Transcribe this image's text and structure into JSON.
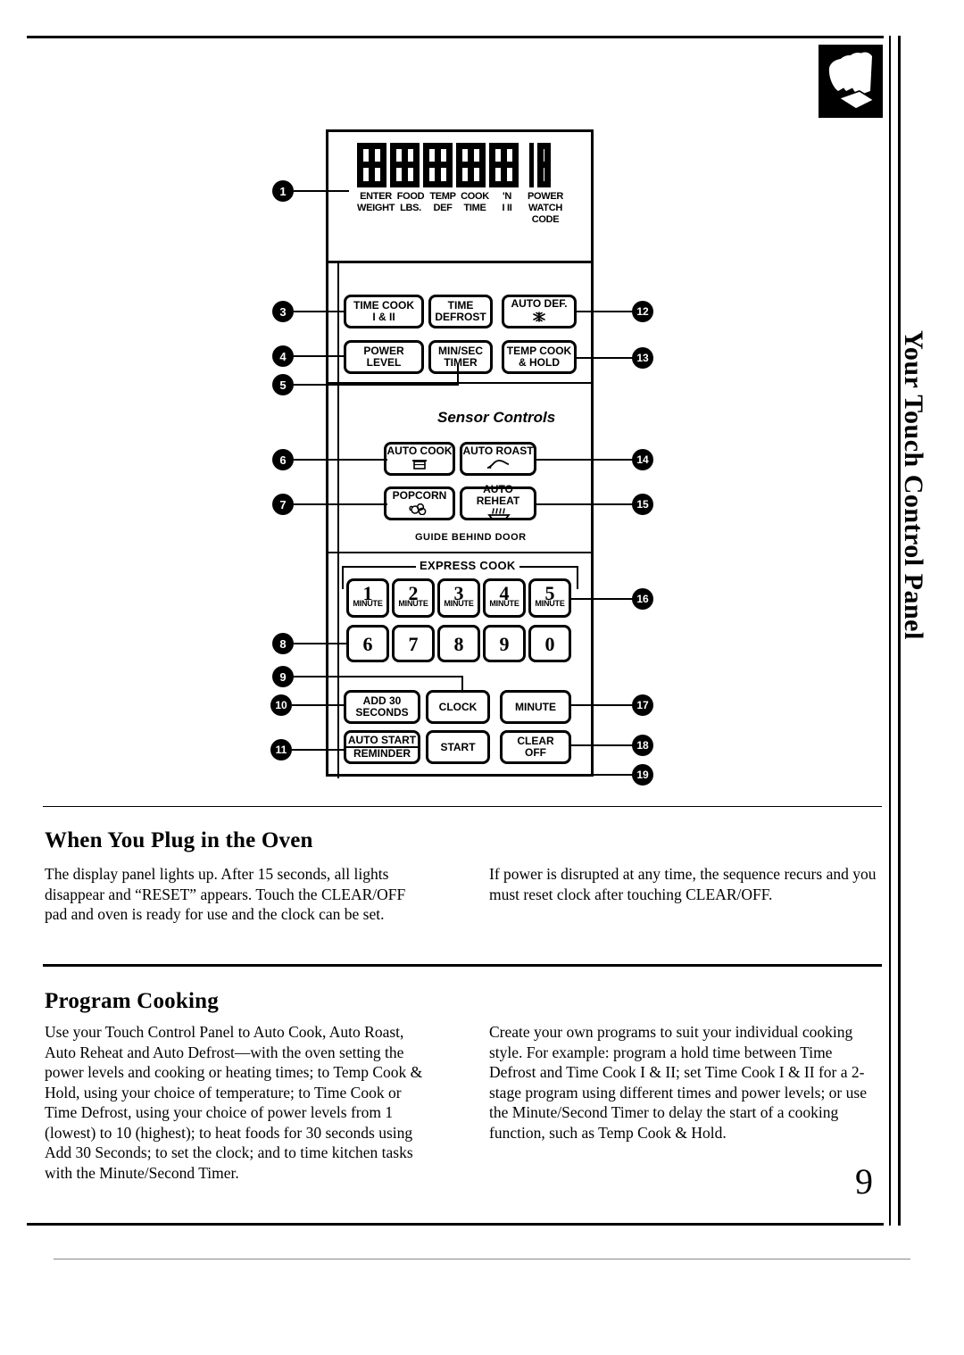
{
  "page": {
    "number": "9",
    "side_tab": "Your Touch Control Panel"
  },
  "icons": {
    "hand_press": "hand-pressing-icon"
  },
  "control_panel": {
    "display": {
      "readout": "88888 18",
      "labels": [
        {
          "top": "ENTER",
          "bottom": "WEIGHT"
        },
        {
          "top": "FOOD",
          "bottom": "LBS."
        },
        {
          "top": "TEMP",
          "bottom": "DEF"
        },
        {
          "top": "COOK",
          "bottom": "TIME"
        },
        {
          "top": "'N",
          "bottom": "I  II"
        },
        {
          "top": "POWER",
          "mid": "WATCH",
          "bottom": "CODE"
        }
      ]
    },
    "buttons": {
      "time_cook": {
        "line1": "TIME COOK",
        "line2": "I & II"
      },
      "time_defrost": {
        "line1": "TIME",
        "line2": "DEFROST"
      },
      "auto_def": {
        "line1": "AUTO DEF.",
        "icon": "snowflake-icon"
      },
      "power_level": {
        "line1": "POWER",
        "line2": "LEVEL"
      },
      "min_sec_timer": {
        "line1": "MIN/SEC",
        "line2": "TIMER"
      },
      "temp_cook_hold": {
        "line1": "TEMP COOK",
        "line2": "& HOLD"
      },
      "auto_cook": {
        "line1": "AUTO COOK",
        "icon": "pot-icon"
      },
      "auto_roast": {
        "line1": "AUTO ROAST",
        "icon": "roast-meat-icon"
      },
      "popcorn": {
        "line1": "POPCORN",
        "icon": "popcorn-icon"
      },
      "auto_reheat": {
        "line1": "AUTO REHEAT",
        "icon": "steaming-dish-icon"
      },
      "add_30_seconds": {
        "line1": "ADD 30",
        "line2": "SECONDS"
      },
      "clock": {
        "line1": "CLOCK"
      },
      "minute": {
        "line1": "MINUTE"
      },
      "auto_start_reminder": {
        "line1": "AUTO START",
        "line2": "REMINDER"
      },
      "start": {
        "line1": "START"
      },
      "clear_off": {
        "line1": "CLEAR",
        "line2": "OFF"
      }
    },
    "sensor_controls_title": "Sensor Controls",
    "guide_text": "GUIDE BEHIND DOOR",
    "express_cook_label": "EXPRESS COOK",
    "keypad": {
      "express_row": [
        {
          "digit": "1",
          "sub": "MINUTE"
        },
        {
          "digit": "2",
          "sub": "MINUTE"
        },
        {
          "digit": "3",
          "sub": "MINUTE"
        },
        {
          "digit": "4",
          "sub": "MINUTE"
        },
        {
          "digit": "5",
          "sub": "MINUTE"
        }
      ],
      "number_row": [
        {
          "digit": "6"
        },
        {
          "digit": "7"
        },
        {
          "digit": "8"
        },
        {
          "digit": "9"
        },
        {
          "digit": "0"
        }
      ]
    },
    "callouts_left": [
      "1",
      "3",
      "4",
      "5",
      "6",
      "7",
      "8",
      "9",
      "10",
      "11"
    ],
    "callouts_right": [
      "12",
      "13",
      "14",
      "15",
      "16",
      "17",
      "18",
      "19"
    ]
  },
  "sections": [
    {
      "heading": "When You Plug in the Oven",
      "left_text": "The display panel lights up. After 15 seconds, all lights disappear and “RESET” appears. Touch the CLEAR/OFF pad and oven is ready for use and the clock can be set.",
      "right_text": "If power is disrupted at any time, the sequence recurs and you must reset clock after touching CLEAR/OFF."
    },
    {
      "heading": "Program  Cooking",
      "left_text": "Use your Touch Control Panel to Auto Cook, Auto Roast, Auto Reheat and Auto Defrost—with the oven setting the power levels and cooking or heating times; to Temp Cook & Hold, using your choice of temperature; to Time Cook or Time Defrost, using your choice of power levels from 1 (lowest) to 10 (highest); to heat foods for 30 seconds using Add 30 Seconds; to set the clock; and to time kitchen tasks with  the  Minute/Second  Timer.",
      "right_text": "Create your own programs to suit your individual cooking style. For example: program a hold time between Time Defrost and Time Cook I & II; set Time Cook I & II for a 2-stage program using different times and power levels; or use the Minute/Second Timer to delay the start of a cooking function, such as Temp Cook & Hold."
    }
  ]
}
